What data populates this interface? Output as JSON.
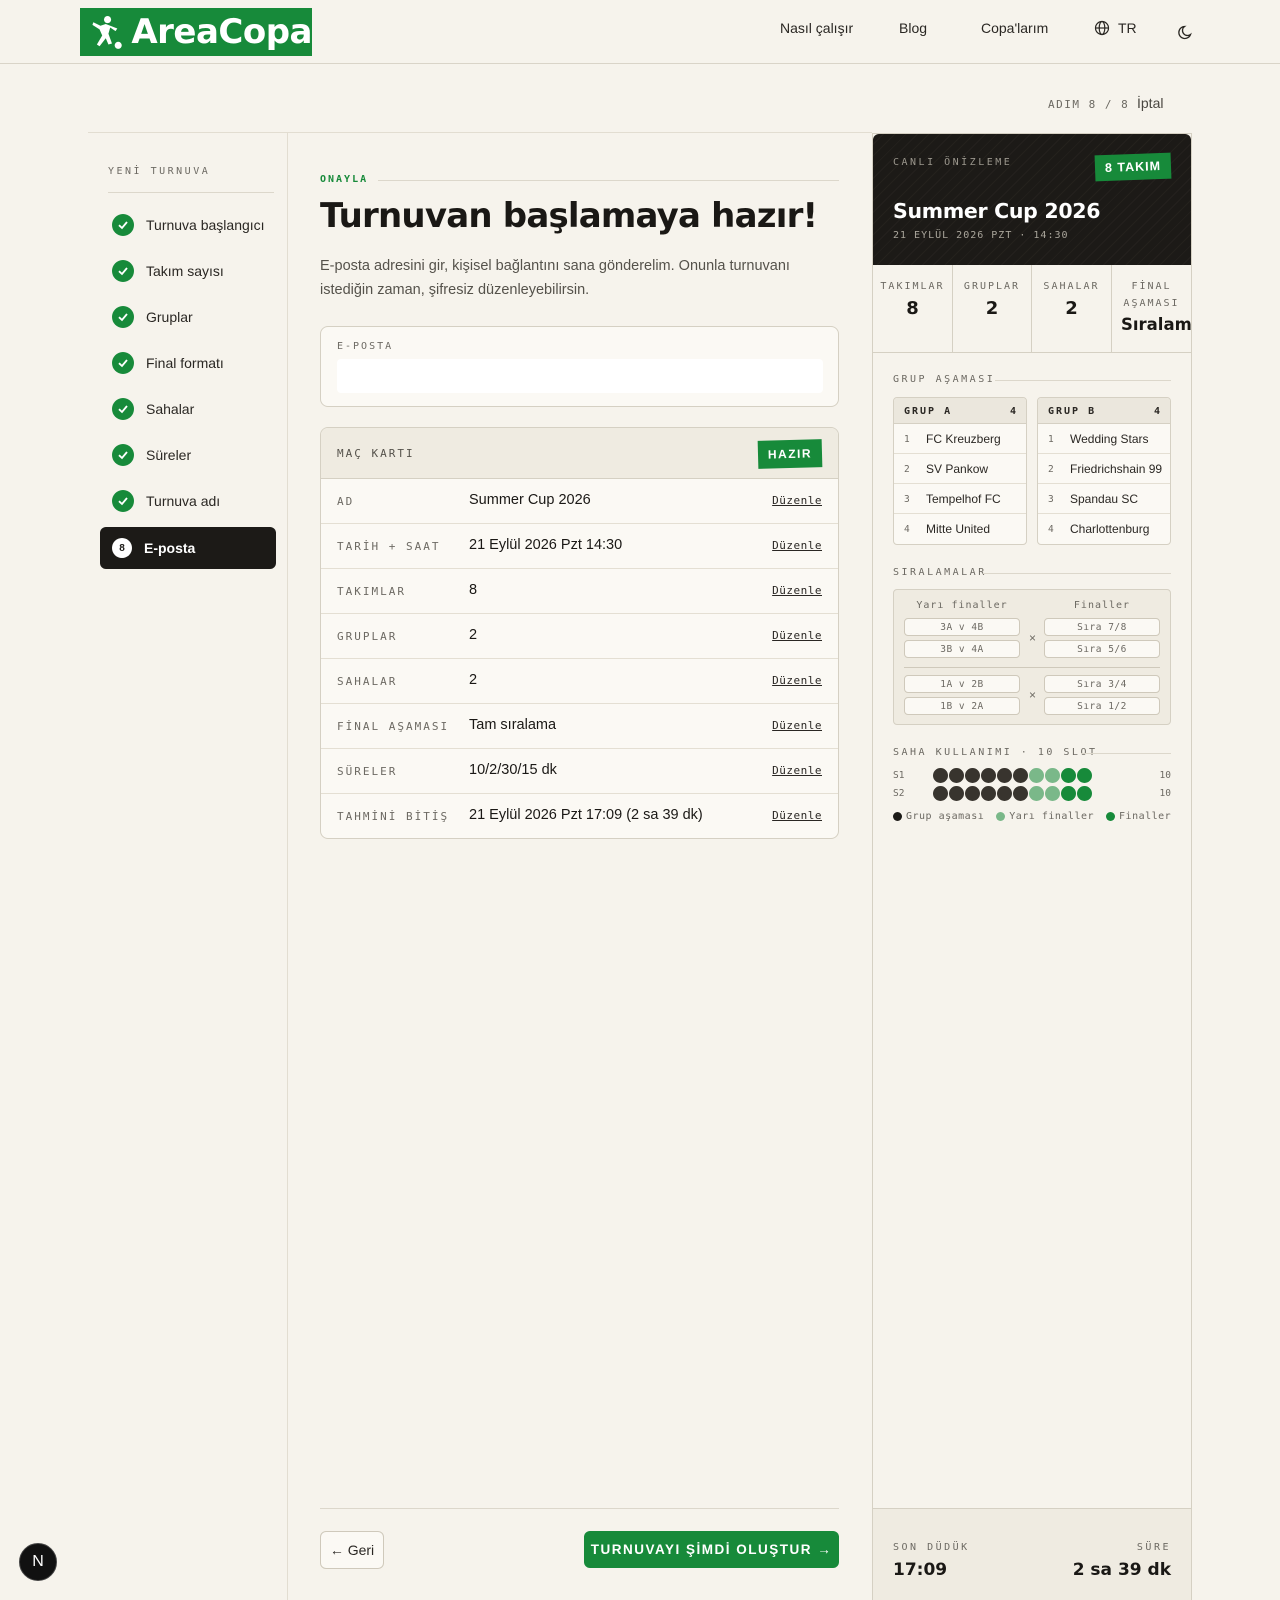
{
  "brand": {
    "name": "AreaCopa",
    "color": "#178a3a"
  },
  "nav": {
    "how": "Nasıl çalışır",
    "blog": "Blog",
    "my_copas": "Copa'larım",
    "lang": "TR"
  },
  "progress": {
    "label": "ADIM 8 / 8",
    "cancel": "İptal"
  },
  "sidebar": {
    "title": "YENİ TURNUVA",
    "steps": [
      {
        "label": "Turnuva başlangıcı"
      },
      {
        "label": "Takım sayısı"
      },
      {
        "label": "Gruplar"
      },
      {
        "label": "Final formatı"
      },
      {
        "label": "Sahalar"
      },
      {
        "label": "Süreler"
      },
      {
        "label": "Turnuva adı"
      },
      {
        "label": "E-posta",
        "num": "8"
      }
    ]
  },
  "main": {
    "eyebrow": "ONAYLA",
    "title": "Turnuvan başlamaya hazır!",
    "lead": "E-posta adresini gir, kişisel bağlantını sana gönderelim. Onunla turnuvanı istediğin zaman, şifresiz düzenleyebilirsin.",
    "email": {
      "label": "E-POSTA",
      "value": "",
      "placeholder": ""
    },
    "match_card": {
      "title": "MAÇ KARTI",
      "badge": "HAZIR",
      "edit": "Düzenle",
      "rows": [
        {
          "key": "AD",
          "value": "Summer Cup 2026"
        },
        {
          "key": "TARİH + SAAT",
          "value": "21 Eylül 2026 Pzt 14:30"
        },
        {
          "key": "TAKIMLAR",
          "value": "8"
        },
        {
          "key": "GRUPLAR",
          "value": "2"
        },
        {
          "key": "SAHALAR",
          "value": "2"
        },
        {
          "key": "FİNAL AŞAMASI",
          "value": "Tam sıralama"
        },
        {
          "key": "SÜRELER",
          "value": "10/2/30/15 dk"
        },
        {
          "key": "TAHMİNİ BİTİŞ",
          "value": "21 Eylül 2026 Pzt 17:09 (2 sa 39 dk)"
        }
      ]
    },
    "back": "← Geri",
    "create": "TURNUVAYI ŞİMDİ OLUŞTUR →"
  },
  "preview": {
    "live": "CANLI ÖNİZLEME",
    "badge": "8 TAKIM",
    "name": "Summer Cup 2026",
    "date": "21 EYLÜL 2026 PZT · 14:30",
    "stats": [
      {
        "key": "TAKIMLAR",
        "value": "8"
      },
      {
        "key": "GRUPLAR",
        "value": "2"
      },
      {
        "key": "SAHALAR",
        "value": "2"
      },
      {
        "key": "FİNAL AŞAMASI",
        "value": "Sıralama"
      }
    ],
    "group_title": "GRUP AŞAMASI",
    "groups": [
      {
        "name": "GRUP A",
        "count": "4",
        "teams": [
          "FC Kreuzberg",
          "SV Pankow",
          "Tempelhof FC",
          "Mitte United"
        ]
      },
      {
        "name": "GRUP B",
        "count": "4",
        "teams": [
          "Wedding Stars",
          "Friedrichshain 99",
          "Spandau SC",
          "Charlottenburg"
        ]
      }
    ],
    "rank_title": "SIRALAMALAR",
    "bracket": {
      "semis_label": "Yarı finaller",
      "finals_label": "Finaller",
      "semis": [
        "3A v 4B",
        "3B v 4A",
        "1A v 2B",
        "1B v 2A"
      ],
      "finals": [
        "Sıra 7/8",
        "Sıra 5/6",
        "Sıra 3/4",
        "Sıra 1/2"
      ],
      "x": "×"
    },
    "usage_title": "SAHA KULLANIMI · 10 SLOT",
    "courts": [
      {
        "label": "S1",
        "count": "10",
        "slots": [
          "g",
          "g",
          "g",
          "g",
          "g",
          "g",
          "s",
          "s",
          "f",
          "f"
        ]
      },
      {
        "label": "S2",
        "count": "10",
        "slots": [
          "g",
          "g",
          "g",
          "g",
          "g",
          "g",
          "s",
          "s",
          "f",
          "f"
        ]
      }
    ],
    "colors": {
      "g": "#38342e",
      "s": "#7ab889",
      "f": "#178a3a"
    },
    "legend": {
      "group": "Grup aşaması",
      "semi": "Yarı finaller",
      "final": "Finaller"
    },
    "footer": {
      "end_label": "SON DÜDÜK",
      "end_value": "17:09",
      "dur_label": "SÜRE",
      "dur_value": "2 sa 39 dk"
    }
  },
  "dev": {
    "label": "N"
  }
}
